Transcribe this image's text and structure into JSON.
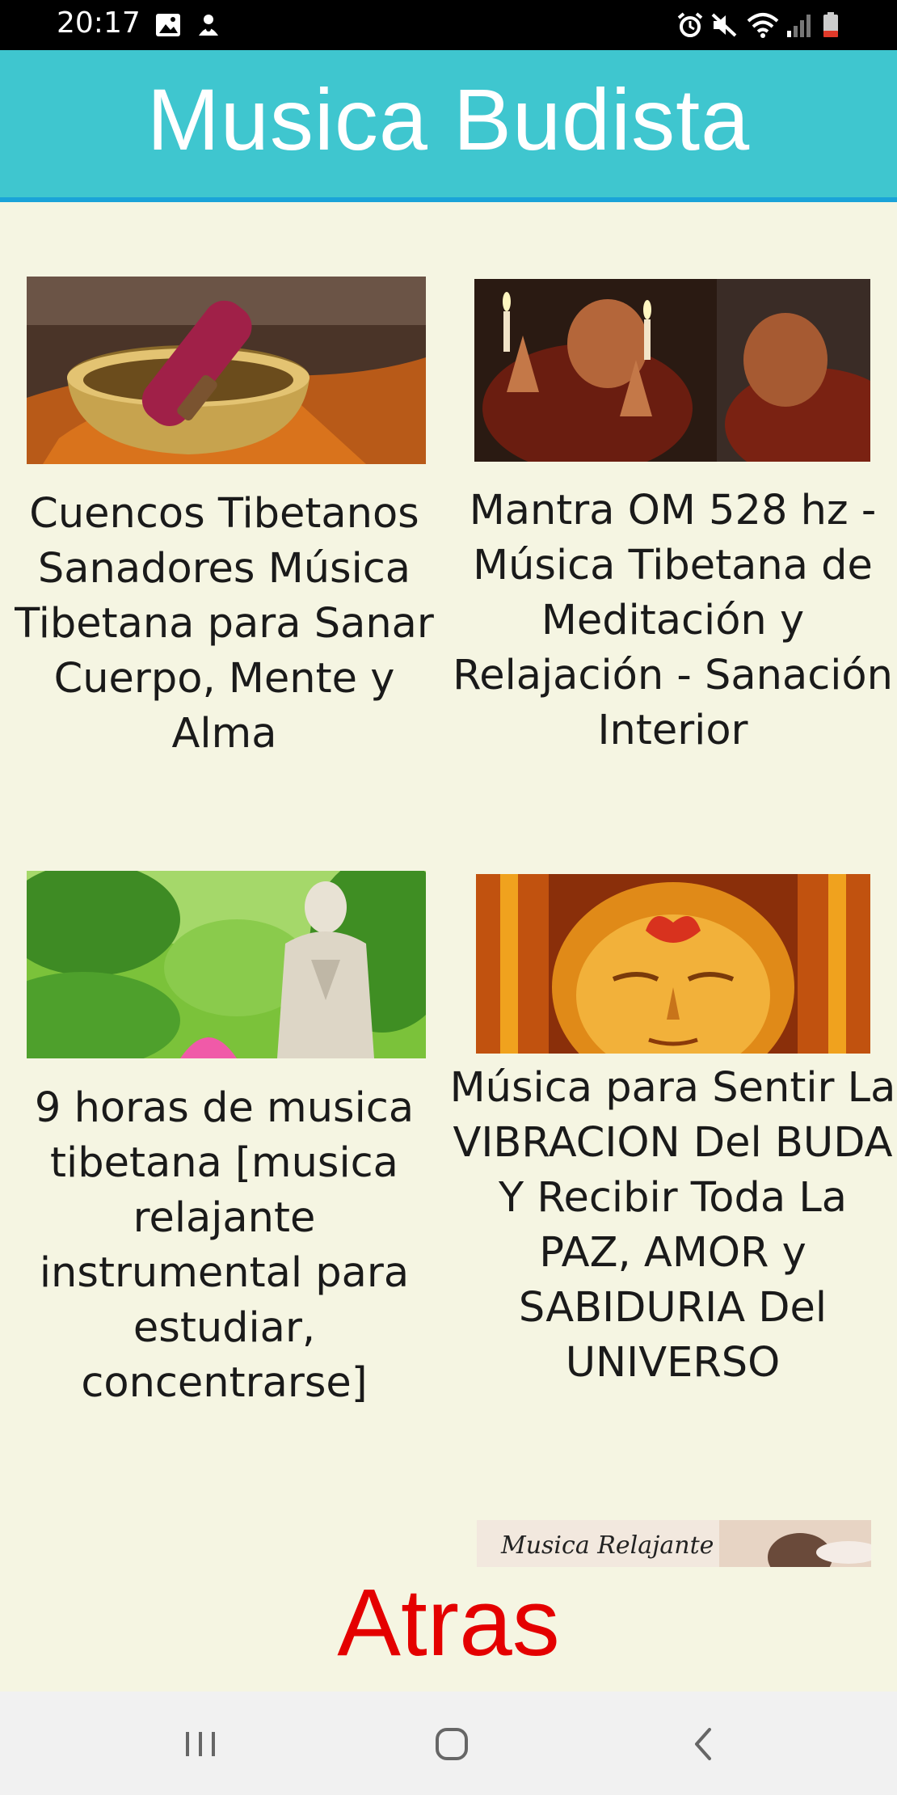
{
  "status_bar": {
    "time": "20:17",
    "left_icons": [
      "image-icon",
      "notification-app-icon"
    ],
    "right_icons": [
      "alarm-icon",
      "mute-icon",
      "wifi-icon",
      "signal-icon",
      "battery-icon"
    ]
  },
  "header": {
    "title": "Musica Budista",
    "background": "#3fc6cf",
    "accent_border": "#1aa3d8"
  },
  "videos": [
    {
      "title": "Cuencos Tibetanos Sanadores Música Tibetana para Sanar Cuerpo, Mente y Alma",
      "thumbnail": "singing-bowl"
    },
    {
      "title": "Mantra OM 528 hz - Música Tibetana de Meditación y Relajación - Sanación Interior",
      "thumbnail": "monks-candles"
    },
    {
      "title": "9 horas de musica tibetana [musica relajante instrumental para estudiar, concentrarse]",
      "thumbnail": "buddha-statue-leaves"
    },
    {
      "title": "Música para Sentir La VIBRACION Del BUDA Y Recibir Toda La PAZ, AMOR y SABIDURIA Del UNIVERSO",
      "thumbnail": "golden-buddha-face"
    },
    {
      "title": "",
      "thumbnail": "musica-relajante",
      "thumbnail_text": "Musica Relajante"
    }
  ],
  "back_button": {
    "label": "Atras",
    "color": "#e40000"
  },
  "nav_bar": {
    "buttons": [
      "recent-apps",
      "home",
      "back"
    ]
  },
  "colors": {
    "page_background": "#f5f5e2",
    "text": "#1a1a1a"
  }
}
